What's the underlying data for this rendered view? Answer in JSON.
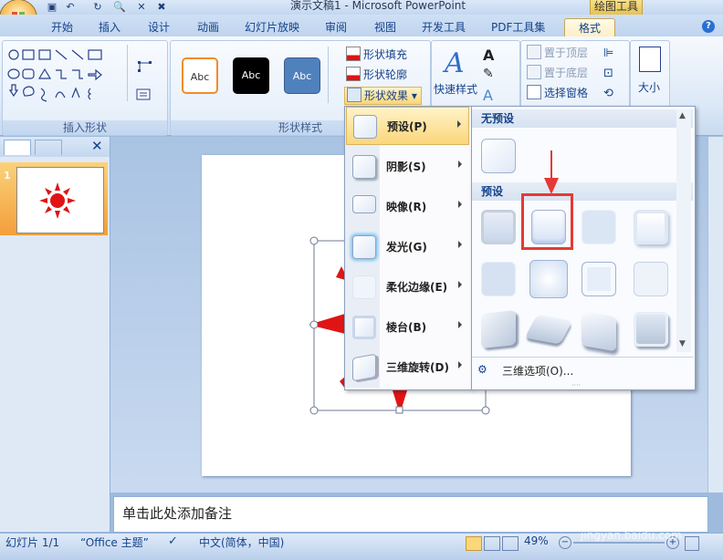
{
  "window": {
    "title": "演示文稿1 - Microsoft PowerPoint",
    "context_tab": "绘图工具"
  },
  "tabs": [
    {
      "label": "开始"
    },
    {
      "label": "插入"
    },
    {
      "label": "设计"
    },
    {
      "label": "动画"
    },
    {
      "label": "幻灯片放映"
    },
    {
      "label": "审阅"
    },
    {
      "label": "视图"
    },
    {
      "label": "开发工具"
    },
    {
      "label": "PDF工具集"
    },
    {
      "label": "格式"
    }
  ],
  "ribbon": {
    "insert_shapes_label": "插入形状",
    "shape_styles_label": "形状样式",
    "swatch_text": "Abc",
    "shape_fill": "形状填充",
    "shape_outline": "形状轮廓",
    "shape_effects": "形状效果",
    "quick_styles": "快速样式",
    "bring_to_front": "置于顶层",
    "send_to_back": "置于底层",
    "selection_pane": "选择窗格",
    "size": "大小"
  },
  "slides_panel": {
    "slide_number": "1"
  },
  "effects_menu": {
    "items": [
      {
        "label": "预设(P)"
      },
      {
        "label": "阴影(S)"
      },
      {
        "label": "映像(R)"
      },
      {
        "label": "发光(G)"
      },
      {
        "label": "柔化边缘(E)"
      },
      {
        "label": "棱台(B)"
      },
      {
        "label": "三维旋转(D)"
      }
    ]
  },
  "preset_gallery": {
    "no_preset_header": "无预设",
    "preset_header": "预设",
    "three_d_options": "三维选项(O)..."
  },
  "notes": {
    "placeholder": "单击此处添加备注"
  },
  "status": {
    "slide_info": "幻灯片 1/1",
    "theme": "“Office 主题”",
    "language": "中文(简体，中国)",
    "zoom": "49%"
  },
  "watermark": {
    "brand": "Bai 经验",
    "url": "jingyan.baidu.com"
  },
  "colors": {
    "accent_red": "#e01414",
    "highlight": "#fbd67a",
    "ribbon_blue": "#15428b"
  }
}
